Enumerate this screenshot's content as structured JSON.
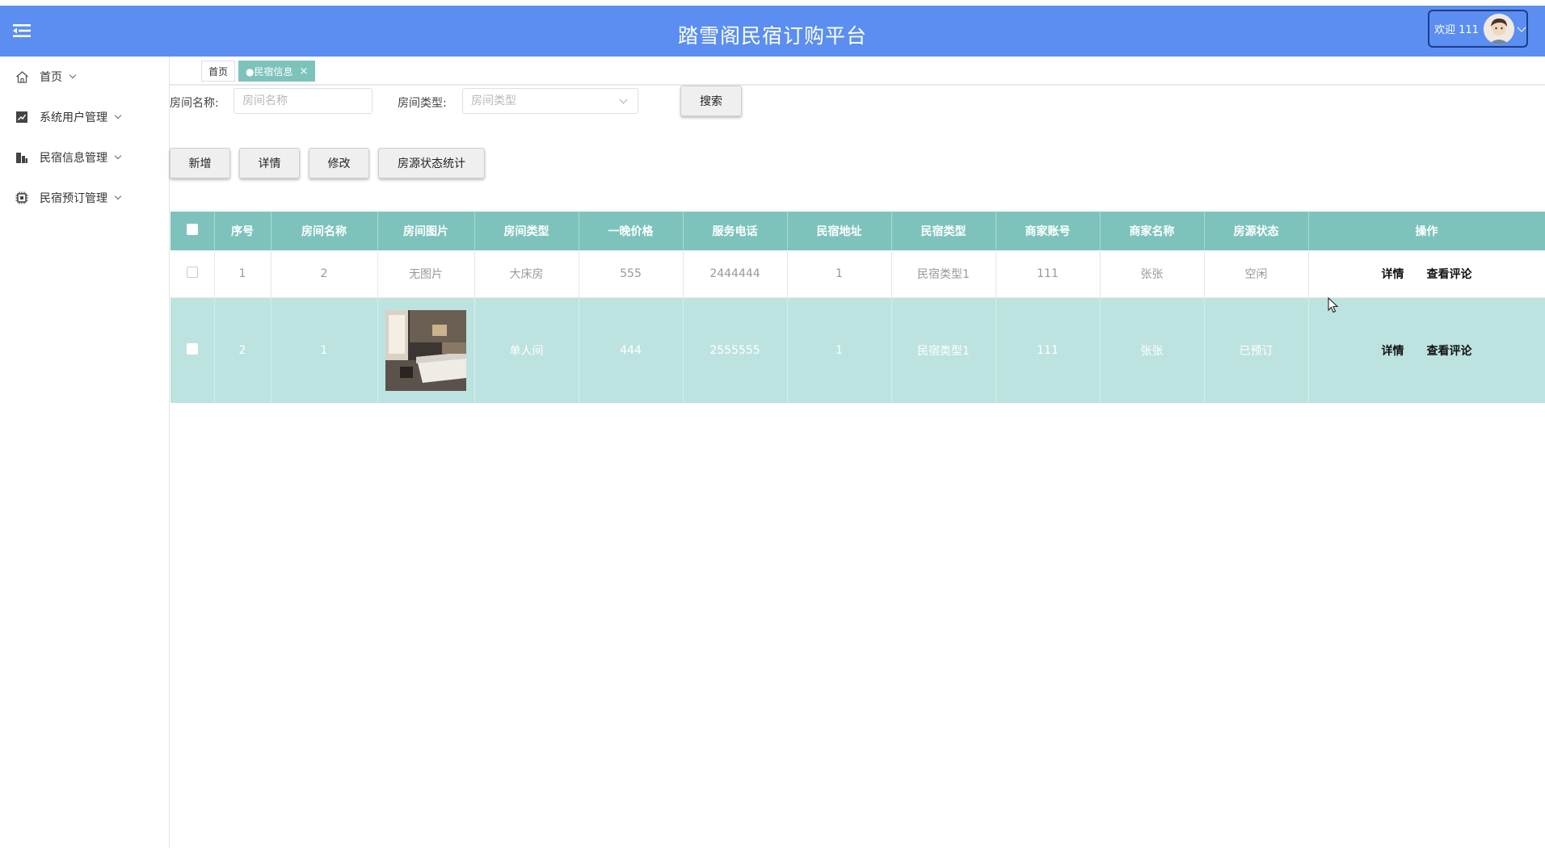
{
  "header": {
    "title": "踏雪阁民宿订购平台",
    "welcome": "欢迎 111"
  },
  "sidebar": {
    "items": [
      {
        "label": "首页",
        "icon": "home-icon"
      },
      {
        "label": "系统用户管理",
        "icon": "chart-icon"
      },
      {
        "label": "民宿信息管理",
        "icon": "building-icon"
      },
      {
        "label": "民宿预订管理",
        "icon": "chip-icon"
      }
    ]
  },
  "tabs": [
    {
      "label": "首页"
    },
    {
      "label": "●民宿信息",
      "close": "×"
    }
  ],
  "search": {
    "room_name_label": "房间名称:",
    "room_name_placeholder": "房间名称",
    "room_type_label": "房间类型:",
    "room_type_placeholder": "房间类型",
    "search_button": "搜索"
  },
  "toolbar": {
    "add": "新增",
    "detail": "详情",
    "edit": "修改",
    "stats": "房源状态统计"
  },
  "table": {
    "columns": [
      "序号",
      "房间名称",
      "房间图片",
      "房间类型",
      "一晚价格",
      "服务电话",
      "民宿地址",
      "民宿类型",
      "商家账号",
      "商家名称",
      "房源状态",
      "操作"
    ],
    "rows": [
      {
        "index": "1",
        "name": "2",
        "image": "无图片",
        "type": "大床房",
        "price": "555",
        "phone": "2444444",
        "address": "1",
        "category": "民宿类型1",
        "account": "111",
        "merchant": "张张",
        "status": "空闲",
        "op_detail": "详情",
        "op_review": "查看评论"
      },
      {
        "index": "2",
        "name": "1",
        "image": "",
        "type": "单人间",
        "price": "444",
        "phone": "2555555",
        "address": "1",
        "category": "民宿类型1",
        "account": "111",
        "merchant": "张张",
        "status": "已预订",
        "op_detail": "详情",
        "op_review": "查看评论"
      }
    ]
  },
  "colors": {
    "topbar": "#5b8ef0",
    "table_header": "#7dc3bc",
    "row_highlight": "#bce3df"
  }
}
